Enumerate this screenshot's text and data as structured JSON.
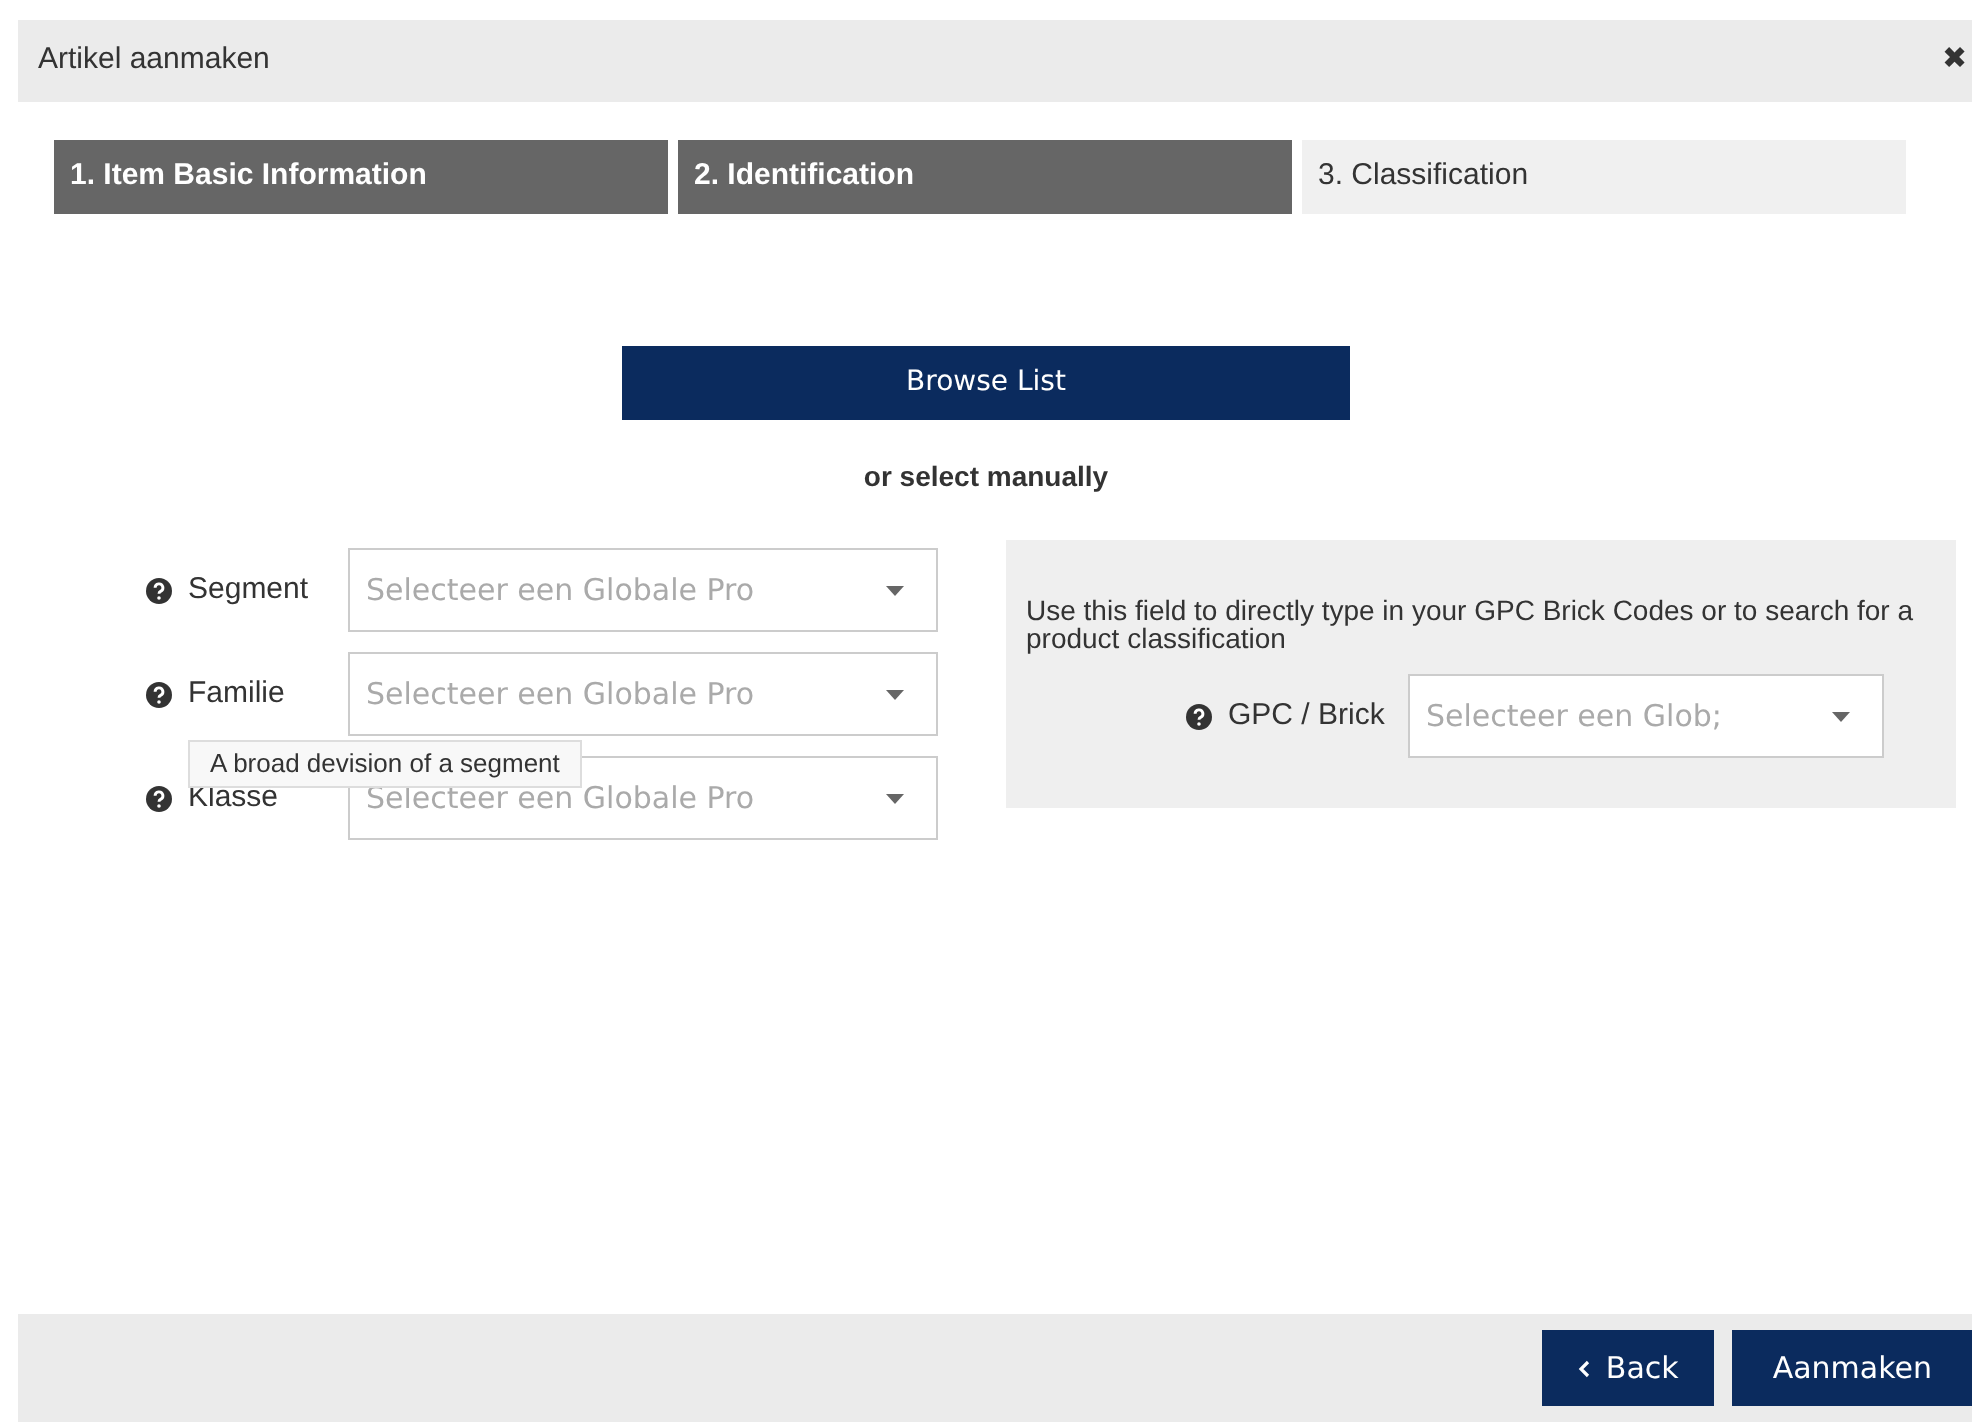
{
  "dialog": {
    "title": "Artikel aanmaken",
    "close": "✖"
  },
  "steps": [
    {
      "label": "1. Item Basic Information",
      "selected": false
    },
    {
      "label": "2. Identification",
      "selected": false
    },
    {
      "label": "3. Classification",
      "selected": true
    }
  ],
  "browse_button": "Browse List",
  "manual_label": "or select manually",
  "fields": [
    {
      "label": "Segment",
      "placeholder": "Selecteer een Globale Pro"
    },
    {
      "label": "Familie",
      "placeholder": "Selecteer een Globale Pro"
    },
    {
      "label": "Klasse",
      "placeholder": "Selecteer een Globale Pro"
    }
  ],
  "tooltip": "A broad devision of a segment",
  "gpc_panel": {
    "hint": "Use this field to directly type in your GPC Brick Codes or to search for a product classification",
    "label": "GPC / Brick",
    "placeholder": "Selecteer een Glob;"
  },
  "footer_buttons": [
    {
      "label": "Back",
      "kind": "back"
    },
    {
      "label": "Aanmaken",
      "kind": "submit"
    }
  ]
}
